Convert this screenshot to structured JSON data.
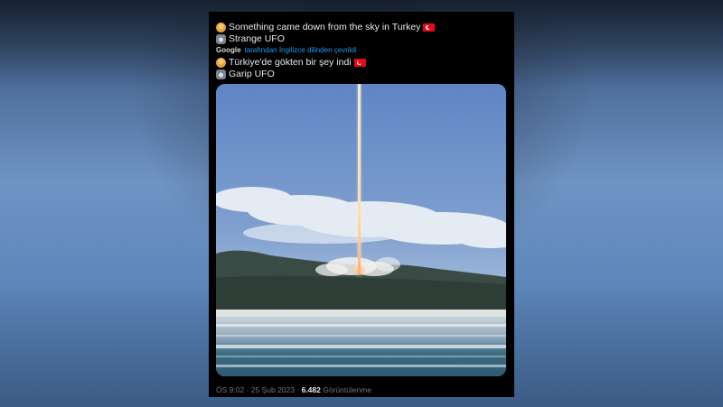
{
  "tweet": {
    "line1": {
      "text": "Something came down from the sky in Turkey",
      "emoji": "person-emoji",
      "flag": "turkey-flag"
    },
    "line2": {
      "text": "Strange UFO",
      "emoji": "camera-emoji"
    },
    "translation": {
      "brand": "Google",
      "note": "tarafından İngilizce dilinden çevrildi"
    },
    "line3": {
      "text": "Türkiye'de gökten bir şey indi",
      "emoji": "person-emoji",
      "flag": "turkey-flag"
    },
    "line4": {
      "text": "Garip UFO",
      "emoji": "camera-emoji"
    },
    "meta": {
      "time": "ÖS 9:02",
      "separator": "·",
      "date": "25 Şub 2023",
      "views": "6.482",
      "views_label": "Görüntülenme"
    }
  },
  "colors": {
    "tweet_bg": "#000000",
    "text": "#e7e9ea",
    "link": "#1d9bf0",
    "meta": "#71767b",
    "flag_red": "#e30a17"
  }
}
